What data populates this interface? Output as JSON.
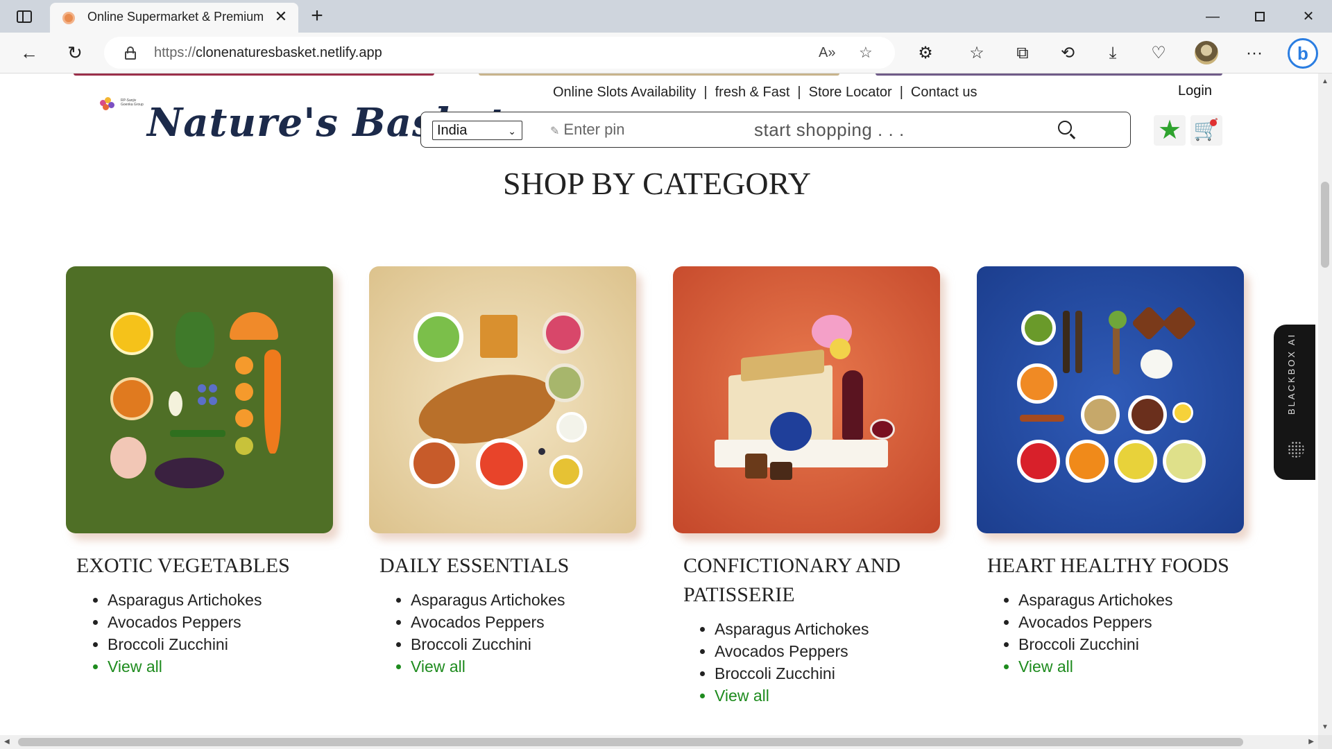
{
  "browser": {
    "tab_title": "Online Supermarket & Premium Gourmet",
    "url_protocol": "https://",
    "url_host": "clonenaturesbasket.netlify.app",
    "new_tab_glyph": "+",
    "close_glyph": "✕",
    "minimize_glyph": "—",
    "back_glyph": "←",
    "reload_glyph": "↻",
    "read_aloud_glyph": "A»",
    "favorite_glyph": "☆",
    "extensions_glyph": "⚙",
    "favorites_glyph": "☆",
    "collections_glyph": "⧉",
    "history_glyph": "⟲",
    "downloads_glyph": "⤓",
    "performance_glyph": "♡",
    "menu_glyph": "···",
    "bing_glyph": "b"
  },
  "site": {
    "logo_text": "Nature's Basket",
    "logo_tagline": "RP-Sanjiv Goenka Group",
    "top_links": [
      "Online Slots Availability",
      "fresh & Fast",
      "Store Locator",
      "Contact us"
    ],
    "link_separator": "|",
    "login_label": "Login",
    "country_selected": "India",
    "pin_placeholder": "Enter pin",
    "search_placeholder": "start shopping . . .",
    "wishlist_glyph": "★",
    "cart_glyph": "🛒"
  },
  "section": {
    "title": "SHOP BY CATEGORY"
  },
  "categories": [
    {
      "title": "EXOTIC VEGETABLES",
      "items": [
        "Asparagus Artichokes",
        "Avocados Peppers",
        "Broccoli Zucchini"
      ],
      "view_all": "View all"
    },
    {
      "title": "DAILY ESSENTIALS",
      "items": [
        "Asparagus Artichokes",
        "Avocados Peppers",
        "Broccoli Zucchini"
      ],
      "view_all": "View all"
    },
    {
      "title": "CONFICTIONARY AND PATISSERIE",
      "items": [
        "Asparagus Artichokes",
        "Avocados Peppers",
        "Broccoli Zucchini"
      ],
      "view_all": "View all"
    },
    {
      "title": "HEART HEALTHY FOODS",
      "items": [
        "Asparagus Artichokes",
        "Avocados Peppers",
        "Broccoli Zucchini"
      ],
      "view_all": "View all"
    }
  ],
  "blackbox": {
    "label": "BLACKBOX AI"
  },
  "colors": {
    "accent_green": "#1e8b1e",
    "star_green": "#2ea32e",
    "logo_navy": "#1c2a4a"
  }
}
